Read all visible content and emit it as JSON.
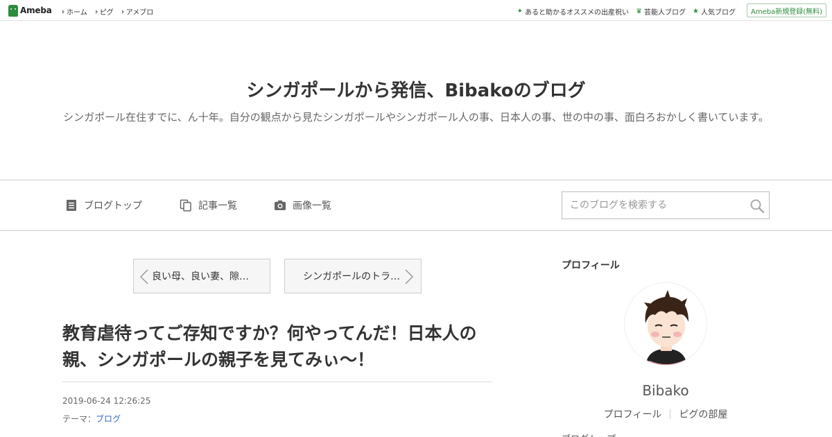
{
  "topbar": {
    "logo_text": "Ameba",
    "nav": [
      "ホーム",
      "ピグ",
      "アメブロ"
    ],
    "right_links": [
      "あると助かるオススメの出産祝い",
      "芸能人ブログ",
      "人気ブログ"
    ],
    "register_label": "Ameba新規登録(無料)"
  },
  "header": {
    "title": "シンガポールから発信、Bibakoのブログ",
    "description": "シンガポール在住すでに、ん十年。自分の観点から見たシンガポールやシンガポール人の事、日本人の事、世の中の事、面白ろおかしく書いています。"
  },
  "navbar": {
    "items": [
      "ブログトップ",
      "記事一覧",
      "画像一覧"
    ],
    "search_placeholder": "このブログを検索する"
  },
  "pager": {
    "prev_label": "良い母、良い妻、隙…",
    "next_label": "シンガポールのトラ…"
  },
  "entry": {
    "title": "教育虐待ってご存知ですか？何やってんだ！日本人の親、シンガポールの親子を見てみぃ〜！",
    "date": "2019-06-24 12:26:25",
    "theme_label": "テーマ：",
    "theme_value": "ブログ"
  },
  "sidebar": {
    "heading": "プロフィール",
    "name": "Bibako",
    "links": [
      "プロフィール",
      "ピグの部屋"
    ],
    "next_heading": "ブログトップ"
  },
  "colors": {
    "ameba_green": "#2d8c3c",
    "link_blue": "#2f6bc4"
  }
}
